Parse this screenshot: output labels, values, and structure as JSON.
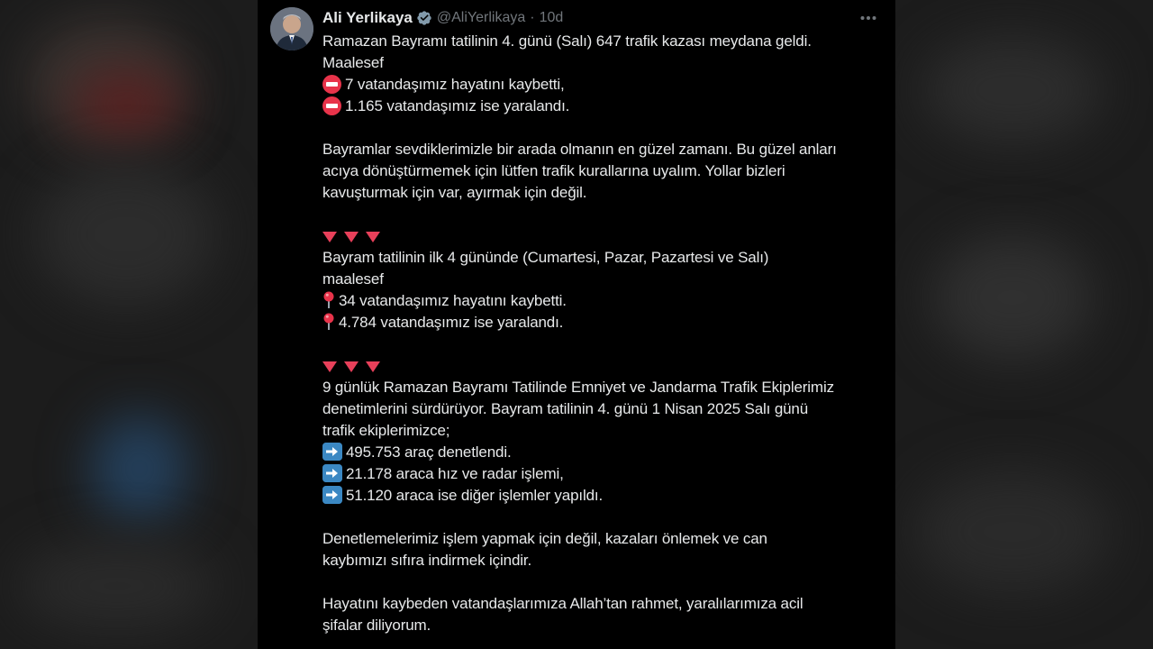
{
  "tweet": {
    "author": {
      "name": "Ali Yerlikaya",
      "handle": "@AliYerlikaya",
      "separator": "·",
      "time": "10d"
    },
    "lines": [
      "Ramazan Bayramı tatilinin 4. günü (Salı) 647 trafik kazası meydana geldi.",
      "Maalesef",
      "7 vatandaşımız hayatını kaybetti,",
      "1.165 vatandaşımız ise yaralandı.",
      "Bayramlar sevdiklerimizle bir arada olmanın en güzel zamanı. Bu güzel anları",
      "acıya dönüştürmemek için lütfen trafik kurallarına uyalım. Yollar bizleri",
      "kavuşturmak için var, ayırmak için değil.",
      "Bayram tatilinin ilk 4 gününde (Cumartesi, Pazar, Pazartesi ve Salı)",
      "maalesef",
      "34 vatandaşımız hayatını kaybetti.",
      "4.784 vatandaşımız ise yaralandı.",
      "9 günlük Ramazan Bayramı Tatilinde Emniyet ve Jandarma Trafik Ekiplerimiz",
      "denetimlerini sürdürüyor. Bayram tatilinin 4. günü 1 Nisan 2025 Salı günü",
      "trafik ekiplerimizce;",
      "495.753 araç denetlendi.",
      "21.178 araca hız ve radar işlemi,",
      "51.120 araca ise diğer işlemler yapıldı.",
      "Denetlemelerimiz işlem yapmak için değil, kazaları önlemek ve can",
      "kaybımızı sıfıra indirmek içindir.",
      "Hayatını kaybeden vatandaşlarımıza Allah’tan rahmet, yaralılarımıza acil",
      "şifalar diliyorum."
    ]
  },
  "icons": {
    "no_entry": "no-entry-emoji",
    "triangle": "red-triangle-down-emoji",
    "pin": "round-pushpin-emoji",
    "arrow": "right-arrow-emoji",
    "verified": "verified-badge-icon",
    "more": "more-options-icon"
  },
  "colors": {
    "background": "#000000",
    "text": "#e7e9ea",
    "muted": "#71767b",
    "verified": "#829aab",
    "emoji_red": "#e8334a",
    "emoji_blue": "#3b88c3"
  }
}
